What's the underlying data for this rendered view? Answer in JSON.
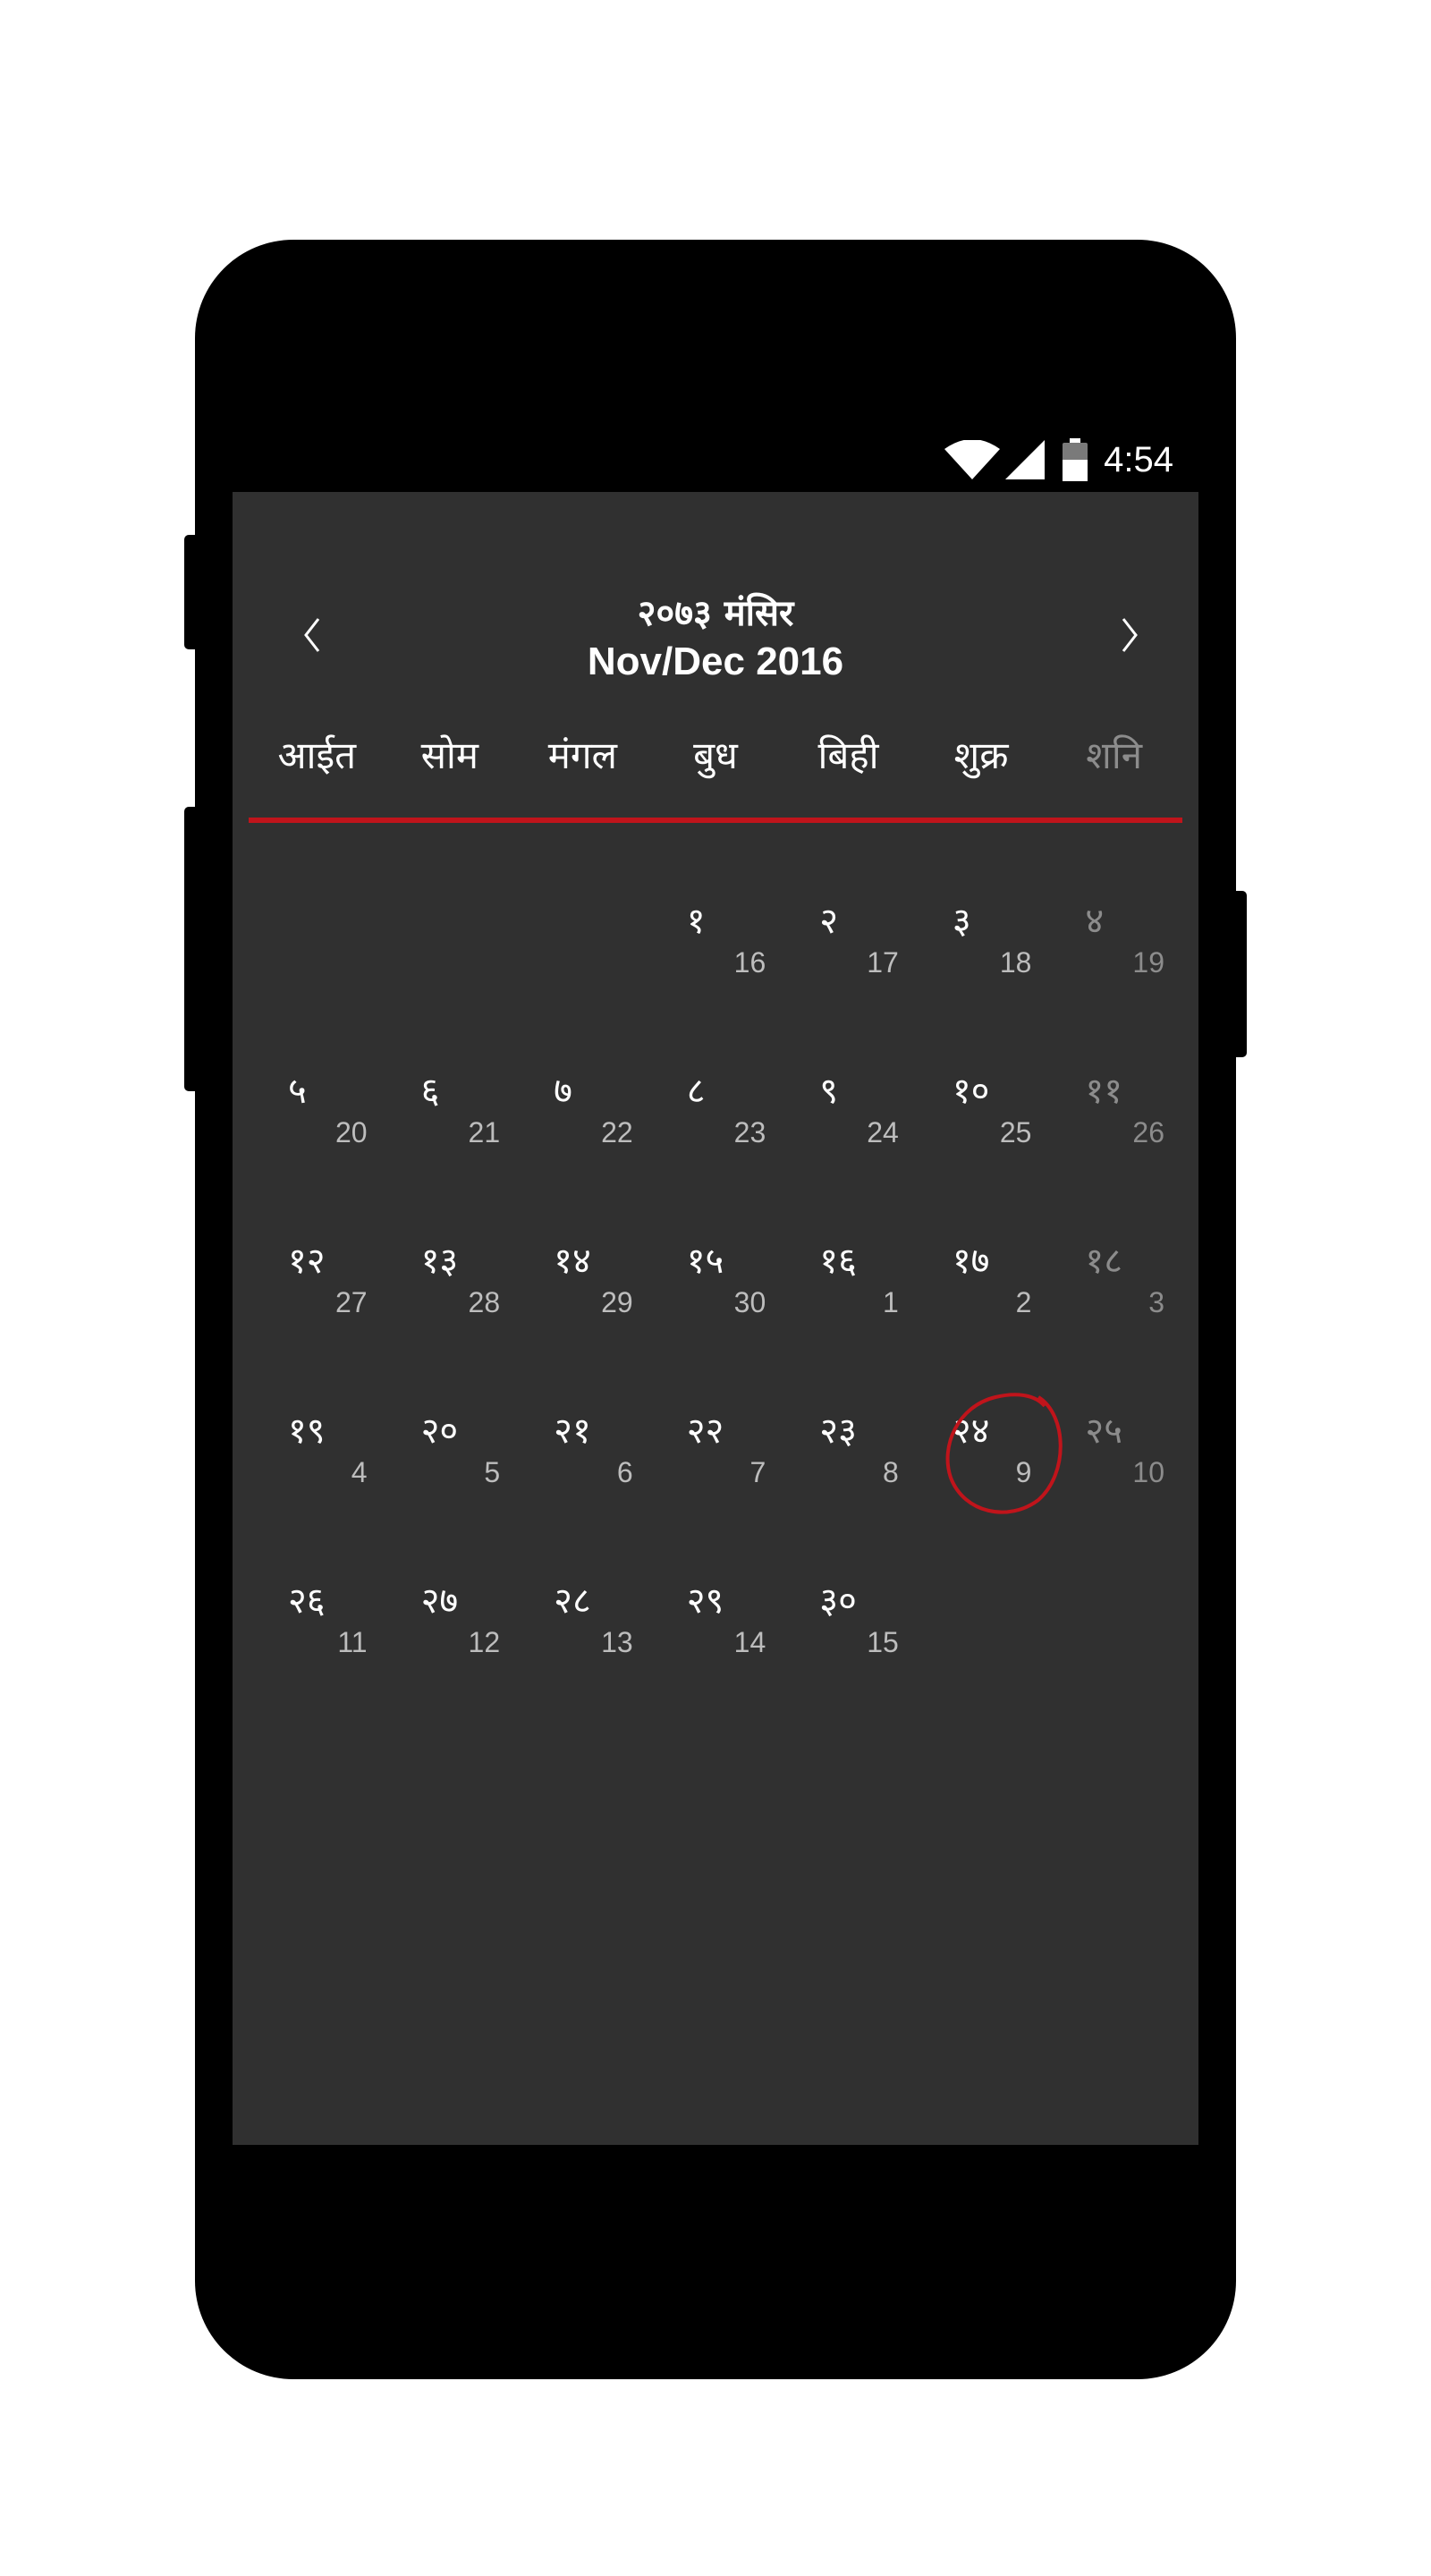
{
  "status_bar": {
    "time": "4:54",
    "icons": [
      "wifi-icon",
      "cell-signal-icon",
      "battery-icon"
    ]
  },
  "header": {
    "title_nepali": "२०७३ मंसिर",
    "title_english": "Nov/Dec 2016",
    "prev_icon": "chevron-left-icon",
    "next_icon": "chevron-right-icon"
  },
  "colors": {
    "accent": "#c0141b",
    "background": "#303030",
    "text": "#ffffff",
    "muted": "#8c8c8c"
  },
  "weekdays": [
    "आईत",
    "सोम",
    "मंगल",
    "बुध",
    "बिही",
    "शुक्र",
    "शनि"
  ],
  "weeks": [
    [
      null,
      null,
      null,
      {
        "np": "१",
        "en": "16"
      },
      {
        "np": "२",
        "en": "17"
      },
      {
        "np": "३",
        "en": "18"
      },
      {
        "np": "४",
        "en": "19"
      }
    ],
    [
      {
        "np": "५",
        "en": "20"
      },
      {
        "np": "६",
        "en": "21"
      },
      {
        "np": "७",
        "en": "22"
      },
      {
        "np": "८",
        "en": "23"
      },
      {
        "np": "९",
        "en": "24"
      },
      {
        "np": "१०",
        "en": "25"
      },
      {
        "np": "११",
        "en": "26"
      }
    ],
    [
      {
        "np": "१२",
        "en": "27"
      },
      {
        "np": "१३",
        "en": "28"
      },
      {
        "np": "१४",
        "en": "29"
      },
      {
        "np": "१५",
        "en": "30"
      },
      {
        "np": "१६",
        "en": "1"
      },
      {
        "np": "१७",
        "en": "2"
      },
      {
        "np": "१८",
        "en": "3"
      }
    ],
    [
      {
        "np": "१९",
        "en": "4"
      },
      {
        "np": "२०",
        "en": "5"
      },
      {
        "np": "२१",
        "en": "6"
      },
      {
        "np": "२२",
        "en": "7"
      },
      {
        "np": "२३",
        "en": "8"
      },
      {
        "np": "२४",
        "en": "9",
        "today": true
      },
      {
        "np": "२५",
        "en": "10"
      }
    ],
    [
      {
        "np": "२६",
        "en": "11"
      },
      {
        "np": "२७",
        "en": "12"
      },
      {
        "np": "२८",
        "en": "13"
      },
      {
        "np": "२९",
        "en": "14"
      },
      {
        "np": "३०",
        "en": "15"
      },
      null,
      null
    ]
  ]
}
